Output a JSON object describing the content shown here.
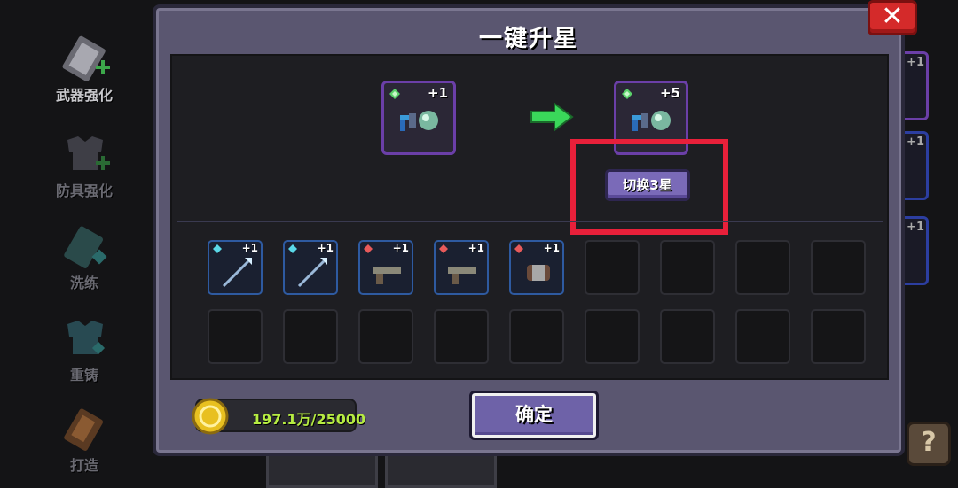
{
  "sidebar": {
    "items": [
      {
        "label": "武器强化",
        "icon": "sword-upgrade-icon"
      },
      {
        "label": "防具强化",
        "icon": "armor-upgrade-icon"
      },
      {
        "label": "洗练",
        "icon": "refine-icon"
      },
      {
        "label": "重铸",
        "icon": "recast-icon"
      },
      {
        "label": "打造",
        "icon": "forge-icon"
      }
    ]
  },
  "background": {
    "right_slots": [
      "+1",
      "+1",
      "+1"
    ],
    "help_label": "?"
  },
  "dialog": {
    "title": "一键升星",
    "close_label": "✕",
    "source_item": {
      "level": "+1",
      "icon": "gun-weapon-icon"
    },
    "target_item": {
      "level": "+5",
      "icon": "gun-weapon-icon"
    },
    "switch_button": "切换3星",
    "materials": [
      {
        "level": "+1",
        "icon": "spear-icon",
        "gem": "cyan"
      },
      {
        "level": "+1",
        "icon": "spear-icon",
        "gem": "cyan"
      },
      {
        "level": "+1",
        "icon": "pistol-icon",
        "gem": "red"
      },
      {
        "level": "+1",
        "icon": "pistol-icon",
        "gem": "red"
      },
      {
        "level": "+1",
        "icon": "bracer-icon",
        "gem": "red"
      }
    ],
    "total_slots": 18,
    "coins": "197.1万/25000",
    "confirm_label": "确定"
  },
  "colors": {
    "panel": "#5a5670",
    "inner": "#1e1e22",
    "accent_purple": "#6b3fa8",
    "highlight_red": "#e8203a",
    "coin_text": "#b6ec42",
    "close_red": "#d42a2a"
  }
}
